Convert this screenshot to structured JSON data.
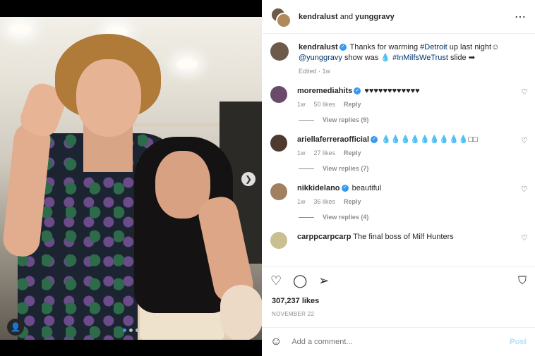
{
  "header": {
    "user1": "kendralust",
    "and": "and",
    "user2": "yunggravy"
  },
  "caption": {
    "username": "kendralust",
    "text_1": "Thanks for warming",
    "tag_detroit": "#Detroit",
    "text_2": "up last night",
    "emoji_1": "☺",
    "mention": "@yunggravy",
    "text_3": "show was",
    "emoji_2": "💧",
    "hashtag_2": "#InMilfsWeTrust",
    "text_4": "slide",
    "emoji_3": "➡",
    "meta": "Edited · 1w"
  },
  "comments": [
    {
      "username": "moremediahits",
      "text": "♥♥♥♥♥♥♥♥♥♥♥♥",
      "time": "1w",
      "likes": "50 likes",
      "reply": "Reply",
      "view_replies": "View replies (9)",
      "avatar_color": "#6a4c6a"
    },
    {
      "username": "ariellaferreraofficial",
      "text": "💧💧💧💧💧💧💧💧💧□□",
      "time": "1w",
      "likes": "27 likes",
      "reply": "Reply",
      "view_replies": "View replies (7)",
      "avatar_color": "#4f3a30"
    },
    {
      "username": "nikkidelano",
      "text": "beautiful",
      "time": "1w",
      "likes": "36 likes",
      "reply": "Reply",
      "view_replies": "View replies (4)",
      "avatar_color": "#a08060"
    },
    {
      "username": "carppcarpcarp",
      "text": "The final boss of Milf Hunters",
      "avatar_color": "#c8c090"
    }
  ],
  "likes": "307,237 likes",
  "date": "NOVEMBER 22",
  "add_comment": {
    "placeholder": "Add a comment...",
    "post": "Post"
  },
  "icons": {
    "more": "⋯",
    "heart": "♡",
    "like": "♡",
    "comment": "◯",
    "share": "➢",
    "bookmark": "⛉",
    "emoji": "☺",
    "next": "❯",
    "user_tag": "👤"
  },
  "colors": {
    "link": "#00376b",
    "verified": "#3897f0",
    "post_disabled": "#b2dffc"
  }
}
